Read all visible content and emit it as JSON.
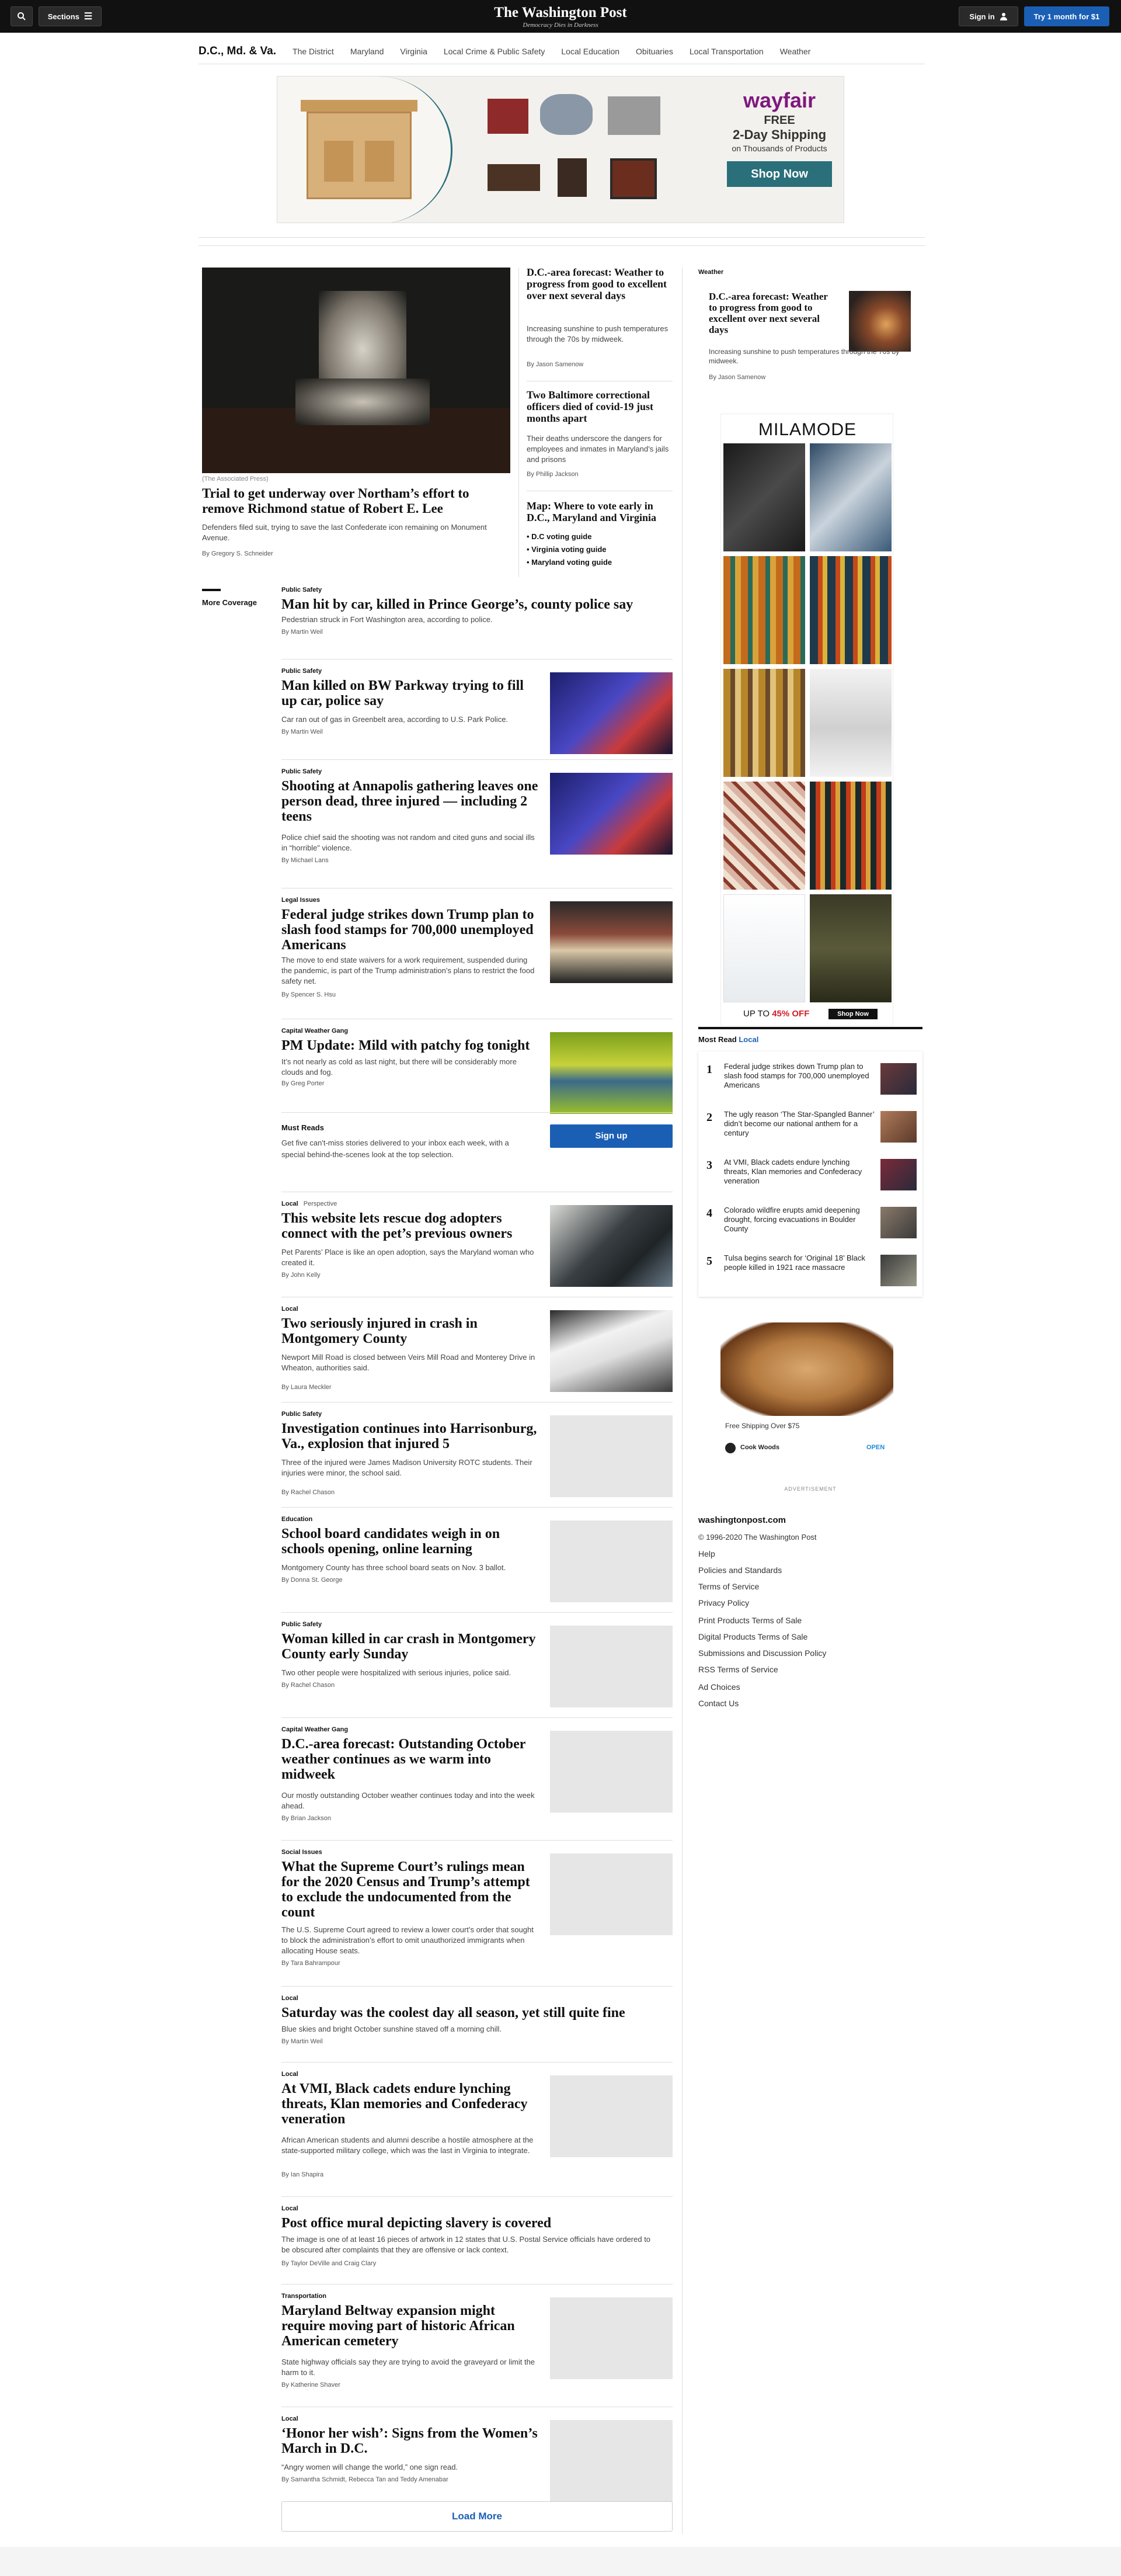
{
  "header": {
    "sections_label": "Sections",
    "brand": "The Washington Post",
    "tagline": "Democracy Dies in Darkness",
    "signin_label": "Sign in",
    "subscribe_label": "Try 1 month for $1"
  },
  "section_nav": {
    "title": "D.C., Md. & Va.",
    "links": [
      "The District",
      "Maryland",
      "Virginia",
      "Local Crime & Public Safety",
      "Local Education",
      "Obituaries",
      "Local Transportation",
      "Weather"
    ]
  },
  "ad_top": {
    "brand": "wayfair",
    "line1": "FREE",
    "line2": "2-Day Shipping",
    "line3": "on Thousands of Products",
    "cta": "Shop Now"
  },
  "lead": {
    "photo_credit": "(The Associated Press)",
    "headline": "Trial to get underway over Northam’s effort to remove Richmond statue of Robert E. Lee",
    "blurb": "Defenders filed suit, trying to save the last Confederate icon remaining on Monument Avenue.",
    "byline": "By Gregory S. Schneider"
  },
  "lead_side": [
    {
      "headline": "D.C.-area forecast: Weather to progress from good to excellent over next several days",
      "blurb": "Increasing sunshine to push temperatures through the 70s by midweek.",
      "byline": "By Jason Samenow"
    },
    {
      "headline": "Two Baltimore correctional officers died of covid-19 just months apart",
      "blurb": "Their deaths underscore the dangers for employees and inmates in Maryland’s jails and prisons",
      "byline": "By Phillip Jackson"
    },
    {
      "headline": "Map: Where to vote early in D.C., Maryland and Virginia",
      "bullets": [
        "D.C voting guide",
        "Virginia voting guide",
        "Maryland voting guide"
      ]
    }
  ],
  "more_coverage_label": "More Coverage",
  "stories": [
    {
      "kicker": "Public Safety",
      "headline": "Man hit by car, killed in Prince George’s, county police say",
      "blurb": "Pedestrian struck in Fort Washington area, according to police.",
      "byline": "By Martin Weil"
    },
    {
      "kicker": "Public Safety",
      "headline": "Man killed on BW Parkway trying to fill up car, police say",
      "blurb": "Car ran out of gas in Greenbelt area, according to U.S. Park Police.",
      "byline": "By Martin Weil"
    },
    {
      "kicker": "Public Safety",
      "headline": "Shooting at Annapolis gathering leaves one person dead, three injured — including 2 teens",
      "blurb": "Police chief said the shooting was not random and cited guns and social ills in “horrible” violence.",
      "byline": "By Michael Lans"
    },
    {
      "kicker": "Legal Issues",
      "headline": "Federal judge strikes down Trump plan to slash food stamps for 700,000 unemployed Americans",
      "blurb": "The move to end state waivers for a work requirement, suspended during the pandemic, is part of the Trump administration’s plans to restrict the food safety net.",
      "byline": "By Spencer S. Hsu"
    },
    {
      "kicker": "Capital Weather Gang",
      "headline": "PM Update: Mild with patchy fog tonight",
      "blurb": "It’s not nearly as cold as last night, but there will be considerably more clouds and fog.",
      "byline": "By Greg Porter"
    },
    {
      "kicker": "Local",
      "kicker2": "Perspective",
      "headline": "This website lets rescue dog adopters connect with the pet’s previous owners",
      "blurb": "Pet Parents’ Place is like an open adoption, says the Maryland woman who created it.",
      "byline": "By John Kelly"
    },
    {
      "kicker": "Local",
      "headline": "Two seriously injured in crash in Montgomery County",
      "blurb": "Newport Mill Road is closed between Veirs Mill Road and Monterey Drive in Wheaton, authorities said.",
      "byline": "By Laura Meckler"
    },
    {
      "kicker": "Public Safety",
      "headline": "Investigation continues into Harrisonburg, Va., explosion that injured 5",
      "blurb": "Three of the injured were James Madison University ROTC students. Their injuries were minor, the school said.",
      "byline": "By Rachel Chason"
    },
    {
      "kicker": "Education",
      "headline": "School board candidates weigh in on schools opening, online learning",
      "blurb": "Montgomery County has three school board seats on Nov. 3 ballot.",
      "byline": "By Donna St. George"
    },
    {
      "kicker": "Public Safety",
      "headline": "Woman killed in car crash in Montgomery County early Sunday",
      "blurb": "Two other people were hospitalized with serious injuries, police said.",
      "byline": "By Rachel Chason"
    },
    {
      "kicker": "Capital Weather Gang",
      "headline": "D.C.-area forecast: Outstanding October weather continues as we warm into midweek",
      "blurb": "Our mostly outstanding October weather continues today and into the week ahead.",
      "byline": "By Brian Jackson"
    },
    {
      "kicker": "Social Issues",
      "headline": "What the Supreme Court’s rulings mean for the 2020 Census and Trump’s attempt to exclude the undocumented from the count",
      "blurb": "The U.S. Supreme Court agreed to review a lower court’s order that sought to block the administration’s effort to omit unauthorized immigrants when allocating House seats.",
      "byline": "By Tara Bahrampour"
    },
    {
      "kicker": "Local",
      "headline": "Saturday was the coolest day all season, yet still quite fine",
      "blurb": "Blue skies and bright October sunshine staved off a morning chill.",
      "byline": "By Martin Weil"
    },
    {
      "kicker": "Local",
      "headline": "At VMI, Black cadets endure lynching threats, Klan memories and Confederacy veneration",
      "blurb": "African American students and alumni describe a hostile atmosphere at the state-supported military college, which was the last in Virginia to integrate.",
      "byline": "By Ian Shapira"
    },
    {
      "kicker": "Local",
      "headline": "Post office mural depicting slavery is covered",
      "blurb": "The image is one of at least 16 pieces of artwork in 12 states that U.S. Postal Service officials have ordered to be obscured after complaints that they are offensive or lack context.",
      "byline": "By Taylor DeVille and Craig Clary"
    },
    {
      "kicker": "Transportation",
      "headline": "Maryland Beltway expansion might require moving part of historic African American cemetery",
      "blurb": "State highway officials say they are trying to avoid the graveyard or limit the harm to it.",
      "byline": "By Katherine Shaver"
    },
    {
      "kicker": "Local",
      "headline": "‘Honor her wish’: Signs from the Women’s March in D.C.",
      "blurb": "“Angry women will change the world,” one sign read.",
      "byline": "By Samantha Schmidt, Rebecca Tan and Teddy Amenabar"
    }
  ],
  "must_reads": {
    "title": "Must Reads",
    "text": "Get five can't-miss stories delivered to your inbox each week, with a special behind-the-scenes look at the top selection.",
    "button": "Sign up"
  },
  "load_more": "Load More",
  "rail": {
    "weather_label": "Weather",
    "weather_headline": "D.C.-area forecast: Weather to progress from good to excellent over next several days",
    "weather_blurb": "Increasing sunshine to push temperatures through the 70s by midweek.",
    "weather_byline": "By Jason Samenow",
    "ad2_brand": "MILAMODE",
    "ad2_promo_a": "UP TO ",
    "ad2_promo_b": "45% OFF",
    "ad2_cta": "Shop Now",
    "most_read_label": "Most Read",
    "most_read_sub": "Local",
    "most_read": [
      {
        "num": "1",
        "text": "Federal judge strikes down Trump plan to slash food stamps for 700,000 unemployed Americans"
      },
      {
        "num": "2",
        "text": "The ugly reason ‘The Star-Spangled Banner’ didn’t become our national anthem for a century"
      },
      {
        "num": "3",
        "text": "At VMI, Black cadets endure lynching threats, Klan memories and Confederacy veneration"
      },
      {
        "num": "4",
        "text": "Colorado wildfire erupts amid deepening drought, forcing evacuations in Boulder County"
      },
      {
        "num": "5",
        "text": "Tulsa begins search for ‘Original 18’ Black people killed in 1921 race massacre"
      }
    ],
    "ad3_text": "Free Shipping Over $75",
    "ad3_brand": "Cook Woods",
    "ad3_cta": "OPEN",
    "ad3_label": "ADVERTISEMENT",
    "footer_site": "washingtonpost.com",
    "footer_copy": "© 1996-2020 The Washington Post",
    "footer_links": [
      "Help",
      "Policies and Standards",
      "Terms of Service",
      "Privacy Policy",
      "Print Products Terms of Sale",
      "Digital Products Terms of Sale",
      "Submissions and Discussion Policy",
      "RSS Terms of Service",
      "Ad Choices",
      "Contact Us"
    ]
  },
  "colors": {
    "accent": "#1a5fb4",
    "topbar": "#111111",
    "subscribe": "#1a5fb4"
  }
}
